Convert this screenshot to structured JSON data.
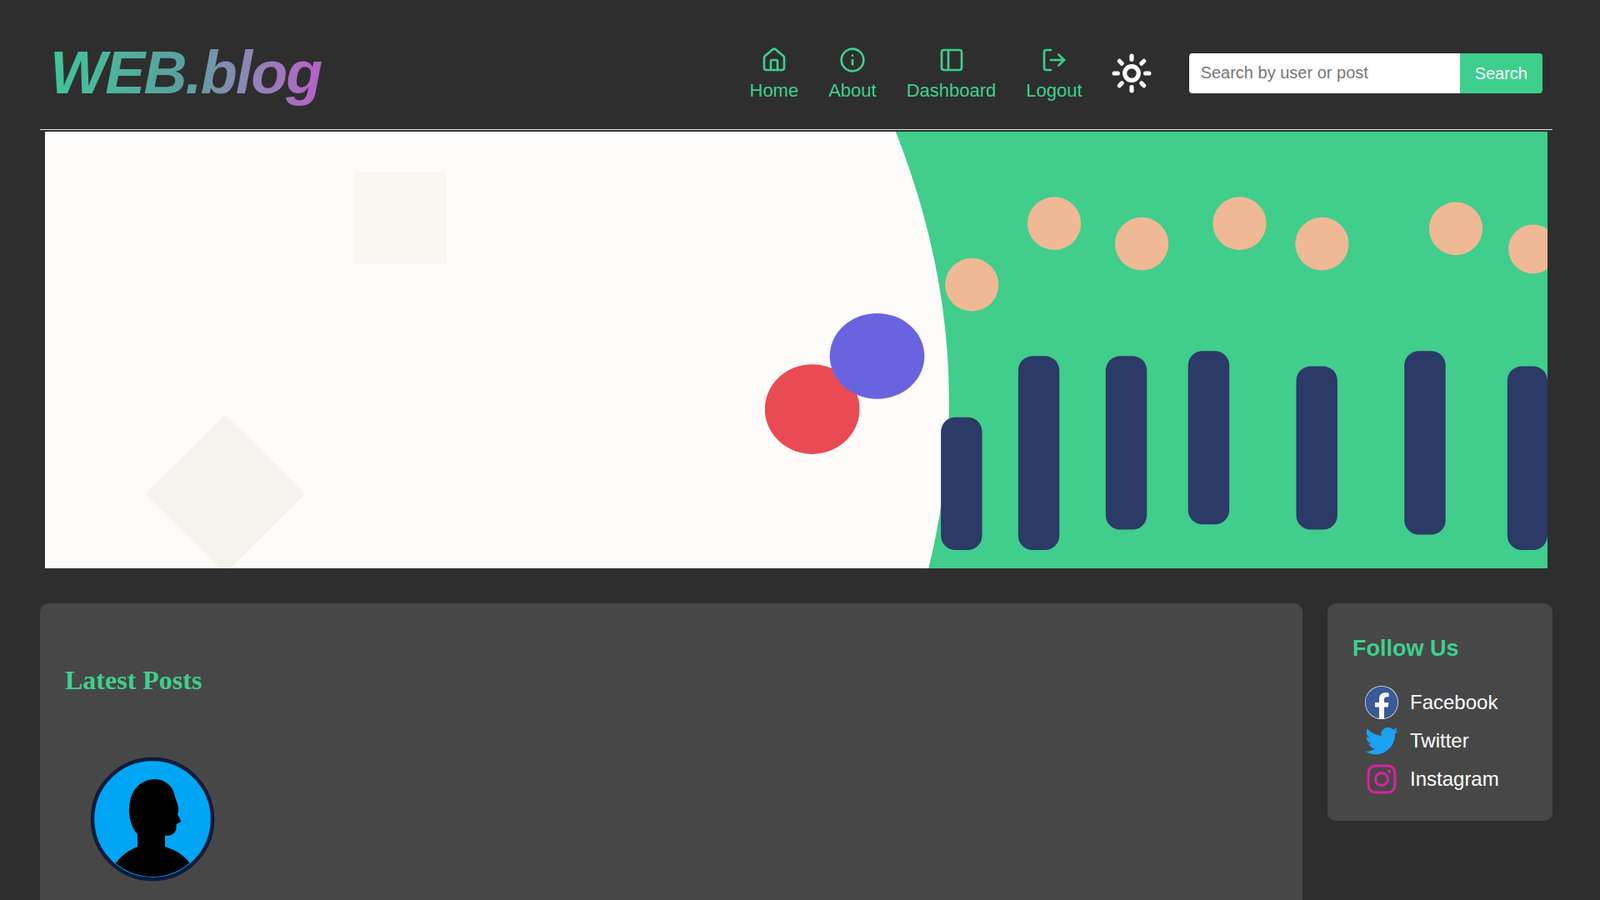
{
  "header": {
    "logo": "WEB.blog",
    "nav": [
      {
        "label": "Home"
      },
      {
        "label": "About"
      },
      {
        "label": "Dashboard"
      },
      {
        "label": "Logout"
      }
    ],
    "search": {
      "placeholder": "Search by user or post",
      "button": "Search"
    }
  },
  "latest_posts": {
    "title": "Latest Posts"
  },
  "sidebar": {
    "title": "Follow Us",
    "links": [
      {
        "label": "Facebook"
      },
      {
        "label": "Twitter"
      },
      {
        "label": "Instagram"
      }
    ]
  }
}
